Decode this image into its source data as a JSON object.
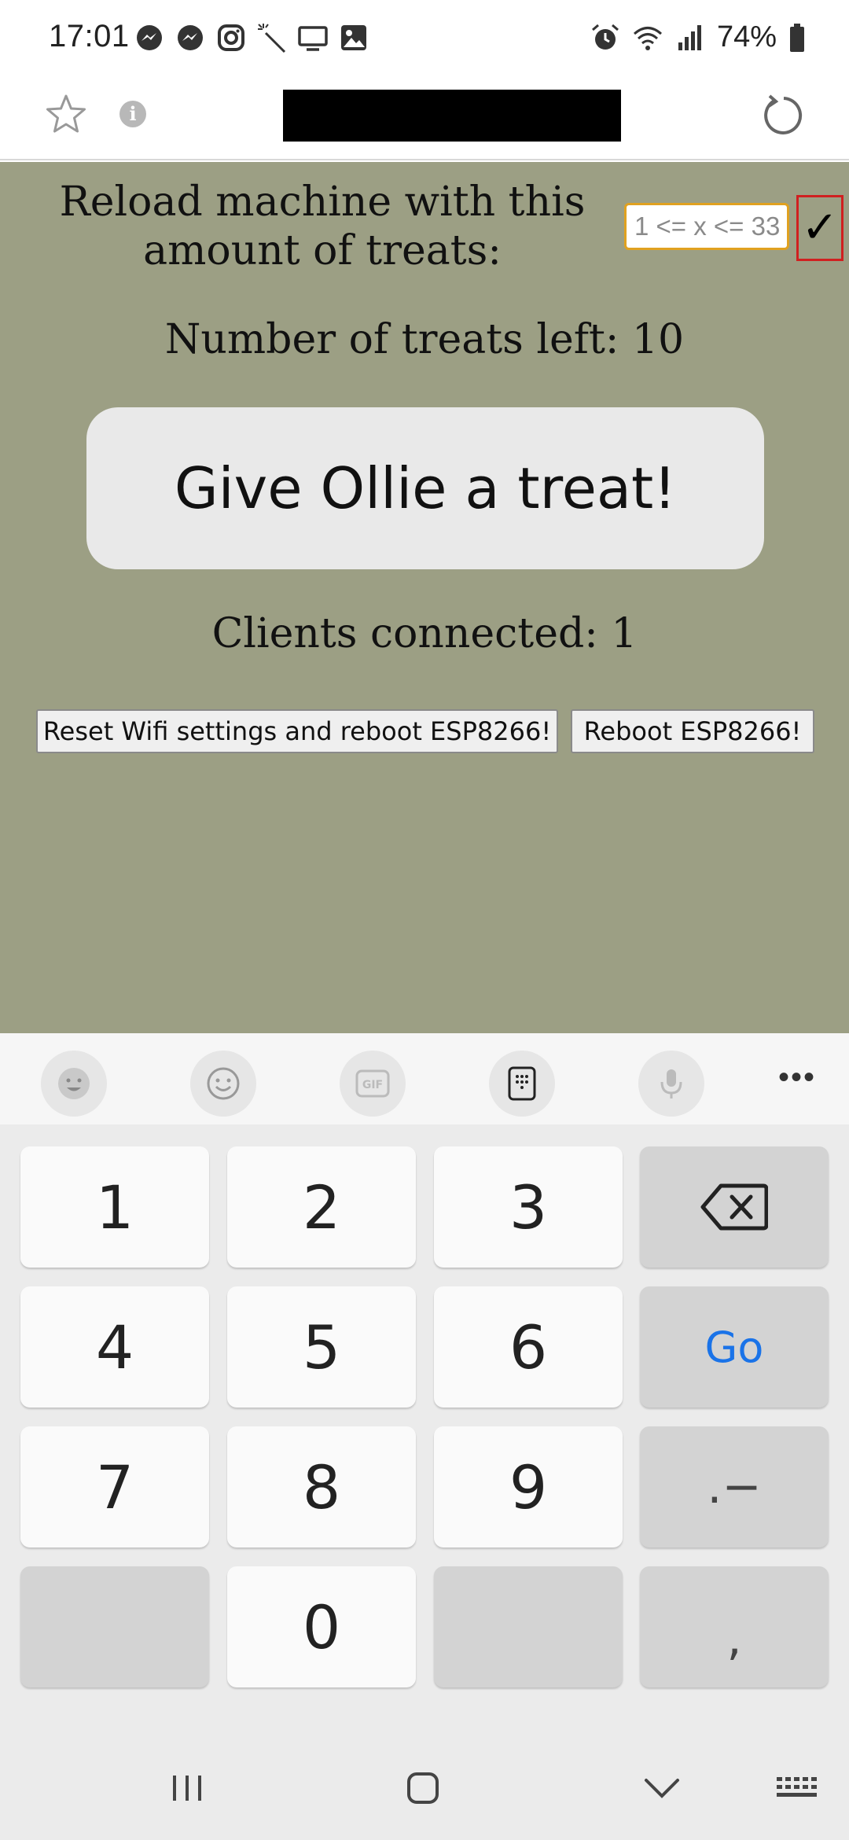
{
  "status_bar": {
    "time": "17:01",
    "battery_percent": "74%",
    "left_icons": [
      "messenger-icon",
      "messenger-icon",
      "instagram-icon",
      "magic-wand-icon",
      "monitor-icon",
      "gallery-icon"
    ],
    "right_icons": [
      "alarm-icon",
      "wifi-icon",
      "signal-icon",
      "battery-icon"
    ]
  },
  "browser": {
    "icons": [
      "star-icon",
      "info-icon",
      "reload-icon"
    ],
    "info_glyph": "i"
  },
  "page": {
    "background_color": "#9c9f84",
    "reload_label": "Reload machine with this amount of treats:",
    "reload_input": {
      "value": "",
      "placeholder": "1 <= x <= 33"
    },
    "confirm_glyph": "✓",
    "treats_left": "Number of treats left: 10",
    "give_treat_button": "Give Ollie a treat!",
    "clients_connected": "Clients connected: 1",
    "reset_wifi_button": "Reset Wifi settings and reboot ESP8266!",
    "reboot_button": "Reboot ESP8266!"
  },
  "keyboard": {
    "toolbar_icons": [
      "bitmoji-icon",
      "emoji-icon",
      "gif-icon",
      "keypad-icon",
      "microphone-icon"
    ],
    "gif_label": "GIF",
    "more_glyph": "•••",
    "keys": {
      "k1": "1",
      "k2": "2",
      "k3": "3",
      "backspace": "⌫",
      "k4": "4",
      "k5": "5",
      "k6": "6",
      "go": "Go",
      "k7": "7",
      "k8": "8",
      "k9": "9",
      "dot_dash": ".−",
      "k0": "0",
      "comma": ","
    },
    "accent_color": "#1a73e8"
  },
  "nav_bar": {
    "icons": [
      "recent-apps-icon",
      "home-icon",
      "back-icon",
      "keyboard-switch-icon"
    ]
  }
}
